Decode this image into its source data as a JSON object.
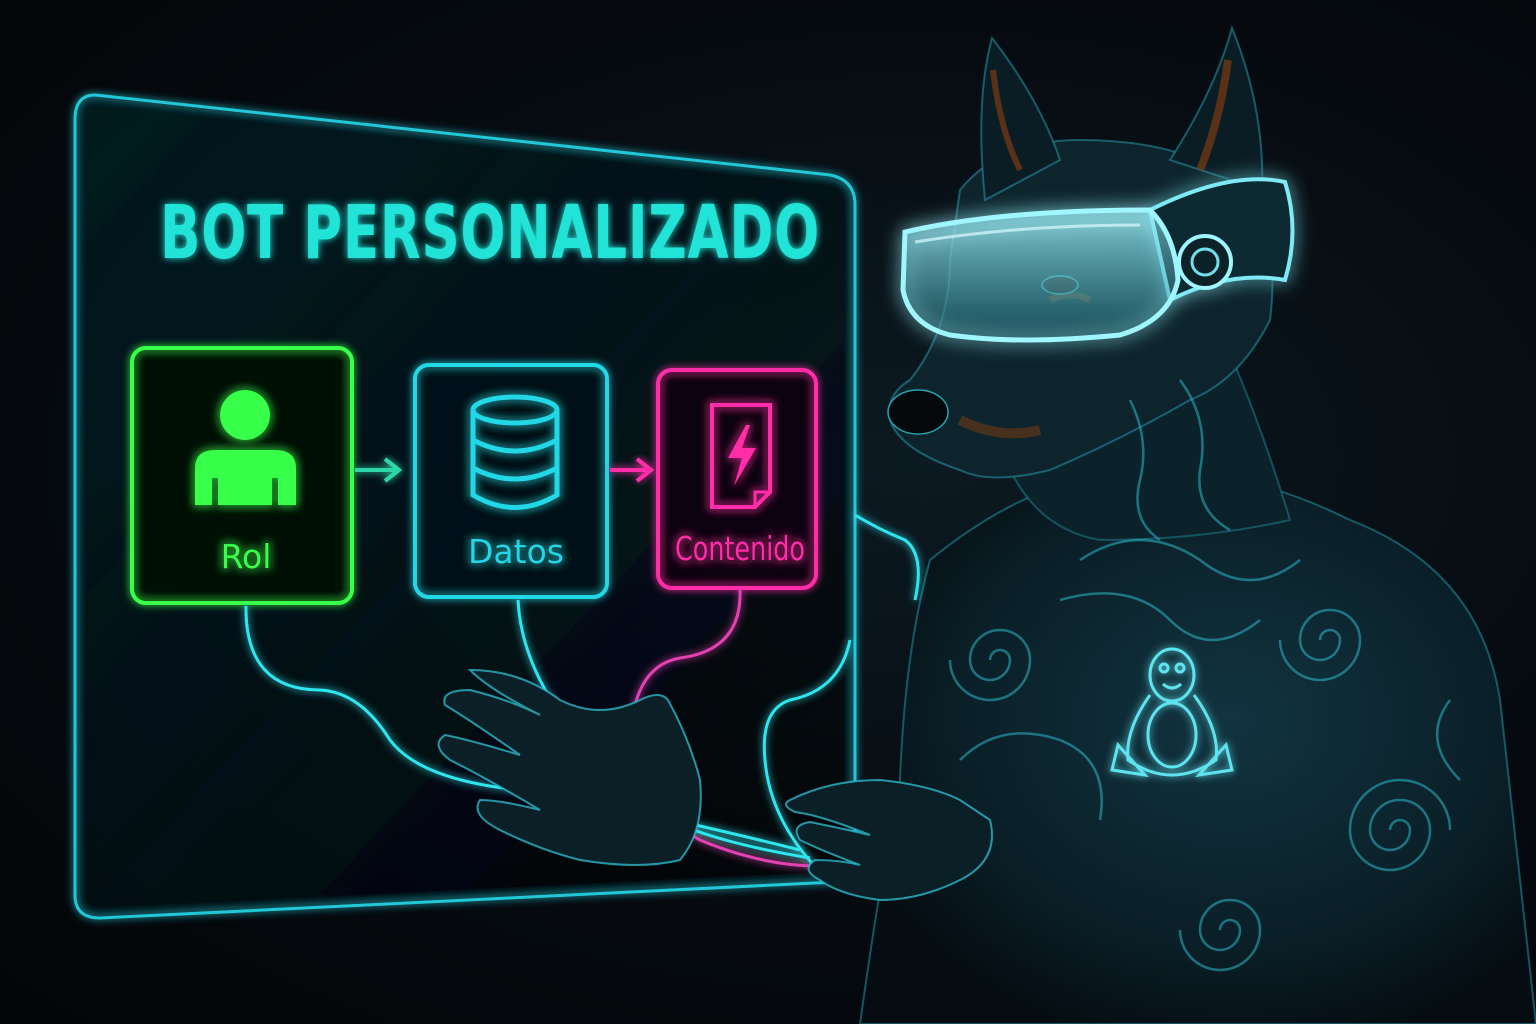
{
  "title": "BOT PERSONALIZADO",
  "steps": [
    {
      "label": "Rol",
      "icon": "person-icon",
      "color": "#39ff4a"
    },
    {
      "label": "Datos",
      "icon": "database-icon",
      "color": "#22d8e6"
    },
    {
      "label": "Contenido",
      "icon": "lightning-document-icon",
      "color": "#ff2fa8"
    }
  ],
  "colors": {
    "background": "#05080b",
    "panel_border": "#22c8d8",
    "title": "#22e3d8",
    "wires": "#2ee6f0",
    "dog_body": "#0c2630",
    "dog_tattoo": "#2bb8c8"
  },
  "figure": {
    "subject": "doberman-with-vr-goggles",
    "chest_emblem": "linux-penguin-icon"
  }
}
